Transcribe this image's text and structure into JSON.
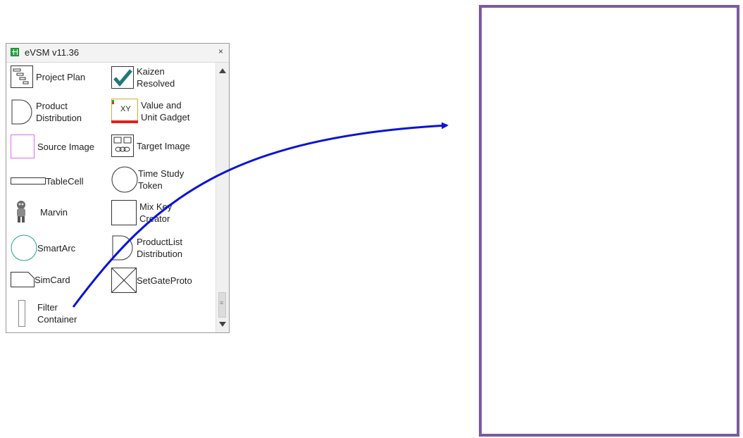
{
  "window": {
    "title": "eVSM v11.36",
    "close_glyph": "×"
  },
  "shapes": [
    {
      "label": "Project Plan",
      "icon": "gantt-icon"
    },
    {
      "label": "Kaizen Resolved",
      "icon": "checkmark-icon"
    },
    {
      "label": "Product Distribution",
      "icon": "d-shape-icon"
    },
    {
      "label": "Value and Unit Gadget",
      "icon": "xy-gadget-icon",
      "icon_text": "XY"
    },
    {
      "label": "Source Image",
      "icon": "pink-square-icon"
    },
    {
      "label": "Target Image",
      "icon": "chain-link-icon"
    },
    {
      "label": "TableCell",
      "icon": "rectangle-icon"
    },
    {
      "label": "Time Study Token",
      "icon": "circle-icon"
    },
    {
      "label": "Marvin",
      "icon": "robot-icon"
    },
    {
      "label": "Mix Key Creator",
      "icon": "square-icon"
    },
    {
      "label": "SmartArc",
      "icon": "teal-circle-icon"
    },
    {
      "label": "ProductList Distribution",
      "icon": "d-shape-icon"
    },
    {
      "label": "SimCard",
      "icon": "card-icon"
    },
    {
      "label": "SetGateProto",
      "icon": "crossed-box-icon"
    },
    {
      "label": "Filter Container",
      "icon": "thin-rectangle-icon"
    }
  ],
  "colors": {
    "drag_arrow": "#0a14d6",
    "canvas_border": "#7b5a9e",
    "app_icon": "#27a744"
  }
}
